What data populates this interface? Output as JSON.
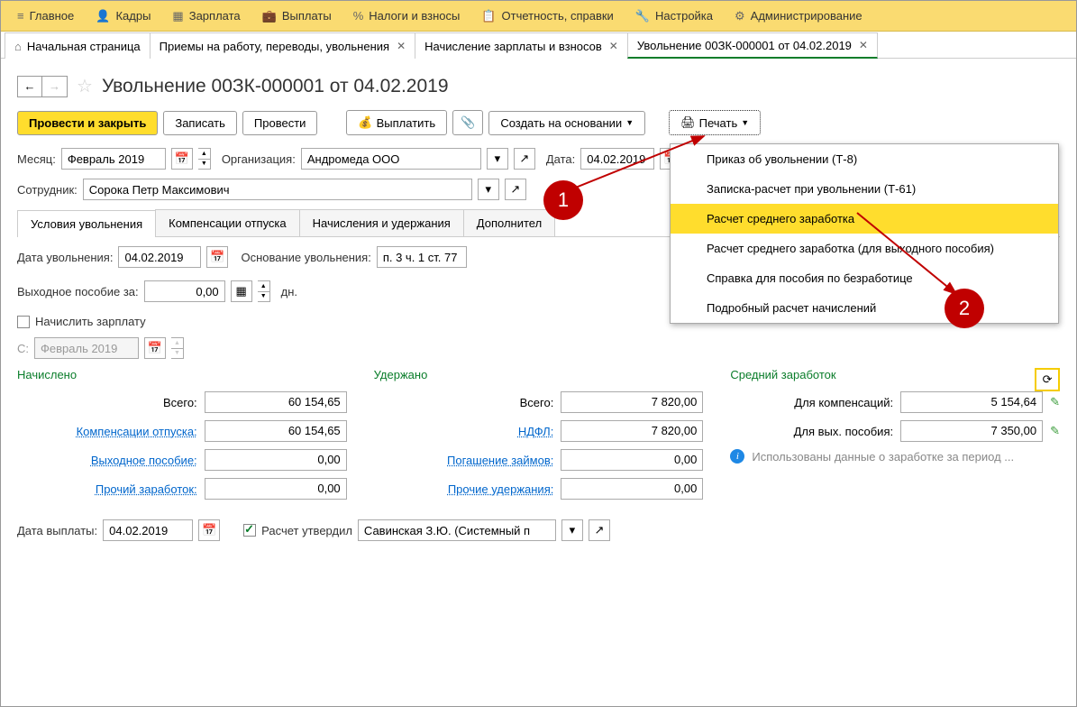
{
  "topmenu": [
    {
      "icon": "≡",
      "label": "Главное"
    },
    {
      "icon": "👤",
      "label": "Кадры"
    },
    {
      "icon": "▦",
      "label": "Зарплата"
    },
    {
      "icon": "💼",
      "label": "Выплаты"
    },
    {
      "icon": "%",
      "label": "Налоги и взносы"
    },
    {
      "icon": "📋",
      "label": "Отчетность, справки"
    },
    {
      "icon": "🔧",
      "label": "Настройка"
    },
    {
      "icon": "⚙",
      "label": "Администрирование"
    }
  ],
  "tabs": [
    {
      "label": "Начальная страница",
      "home": true,
      "active": false,
      "closable": false
    },
    {
      "label": "Приемы на работу, переводы, увольнения",
      "active": false,
      "closable": true
    },
    {
      "label": "Начисление зарплаты и взносов",
      "active": false,
      "closable": true
    },
    {
      "label": "Увольнение 00ЗК-000001 от 04.02.2019",
      "active": true,
      "closable": true
    }
  ],
  "page_title": "Увольнение 00ЗК-000001 от 04.02.2019",
  "toolbar": {
    "post_close": "Провести и закрыть",
    "save": "Записать",
    "post": "Провести",
    "pay": "Выплатить",
    "create_based": "Создать на основании",
    "print": "Печать"
  },
  "fields": {
    "month_label": "Месяц:",
    "month": "Февраль 2019",
    "org_label": "Организация:",
    "org": "Андромеда ООО",
    "date_label": "Дата:",
    "date": "04.02.2019",
    "emp_label": "Сотрудник:",
    "emp": "Сорока Петр Максимович",
    "dismiss_date_label": "Дата увольнения:",
    "dismiss_date": "04.02.2019",
    "basis_label": "Основание увольнения:",
    "basis": "п. 3 ч. 1 ст. 77",
    "severance_label": "Выходное пособие за:",
    "severance": "0,00",
    "severance_unit": "дн.",
    "accrue_salary": "Начислить зарплату",
    "from_label": "С:",
    "from": "Февраль 2019",
    "pay_date_label": "Дата выплаты:",
    "pay_date": "04.02.2019",
    "approved": "Расчет утвердил",
    "approver": "Савинская З.Ю. (Системный п"
  },
  "doctabs": [
    "Условия увольнения",
    "Компенсации отпуска",
    "Начисления и удержания",
    "Дополнител"
  ],
  "sections": {
    "accrued": "Начислено",
    "withheld": "Удержано",
    "avg": "Средний заработок"
  },
  "accrued": {
    "total_l": "Всего:",
    "total": "60 154,65",
    "comp_l": "Компенсации отпуска:",
    "comp": "60 154,65",
    "sev_l": "Выходное пособие:",
    "sev": "0,00",
    "other_l": "Прочий заработок:",
    "other": "0,00"
  },
  "withheld": {
    "total_l": "Всего:",
    "total": "7 820,00",
    "ndfl_l": "НДФЛ:",
    "ndfl": "7 820,00",
    "loan_l": "Погашение займов:",
    "loan": "0,00",
    "other_l": "Прочие удержания:",
    "other": "0,00"
  },
  "avg": {
    "comp_l": "Для компенсаций:",
    "comp": "5 154,64",
    "sev_l": "Для вых. пособия:",
    "sev": "7 350,00",
    "note": "Использованы данные о заработке за период ..."
  },
  "print_menu": [
    "Приказ об увольнении (Т-8)",
    "Записка-расчет при увольнении (Т-61)",
    "Расчет среднего заработка",
    "Расчет среднего заработка (для выходного пособия)",
    "Справка для пособия по безработице",
    "Подробный расчет начислений"
  ],
  "print_menu_hl": 2,
  "callouts": {
    "c1": "1",
    "c2": "2"
  }
}
